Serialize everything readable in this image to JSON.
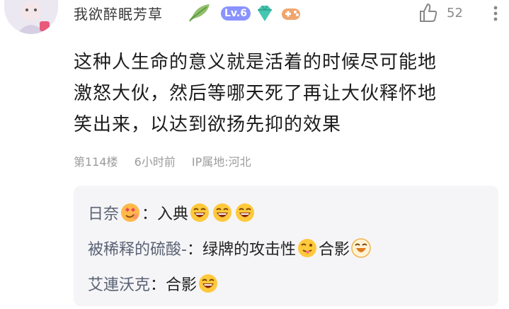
{
  "comment": {
    "username": "我欲醉眠芳草",
    "level_badge": "Lv.6",
    "like_count": "52",
    "content_lines": [
      "这种人生命的意义就是活着的时候尽可能地",
      "激怒大伙，然后等哪天死了再让大伙释怀地",
      "笑出来，以达到欲扬先抑的效果"
    ],
    "floor": "第114楼",
    "time": "6小时前",
    "ip_location": "IP属地:河北"
  },
  "replies": [
    {
      "name": "日奈",
      "separator": "：",
      "text": "入典"
    },
    {
      "name": "被稀释的硫酸-",
      "separator": "：",
      "text": "绿牌的攻击性",
      "text2": "合影"
    },
    {
      "name": "艾連沃克",
      "separator": "：",
      "text": "合影"
    }
  ],
  "colors": {
    "level_badge": "#8a93ff",
    "name": "#5a6274",
    "meta": "#9b9b9b",
    "reply_bg": "#f5f5f7"
  },
  "icons": [
    "leaf-badge-icon",
    "diamond-icon",
    "gamepad-icon",
    "thumbs-up-icon",
    "more-icon",
    "laughing-emoji-icon",
    "heart-eyes-emoji-icon",
    "tongue-emoji-icon"
  ]
}
